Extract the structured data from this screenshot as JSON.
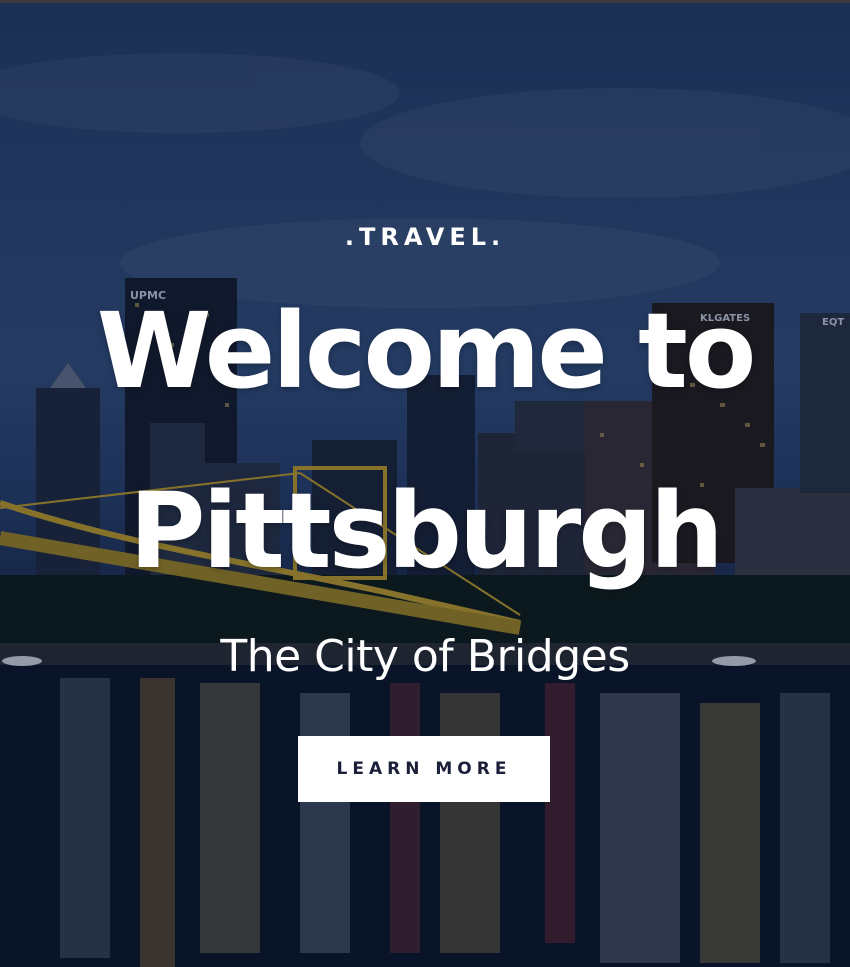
{
  "hero": {
    "eyebrow": ".TRAVEL.",
    "title_line1": "Welcome to",
    "title_line2": "Pittsburgh",
    "subtitle": "The City of Bridges",
    "cta_label": "LEARN MORE"
  },
  "background": {
    "image_description": "Night skyline with yellow bridge and reflections on river",
    "building_signs": [
      "UPMC",
      "KLGATES",
      "EQT"
    ]
  },
  "colors": {
    "sky": "#2f4a78",
    "water": "#0c1426",
    "bridge": "#c9a52a",
    "text": "#ffffff",
    "cta_background": "#ffffff",
    "cta_text": "#1c1f3a"
  }
}
